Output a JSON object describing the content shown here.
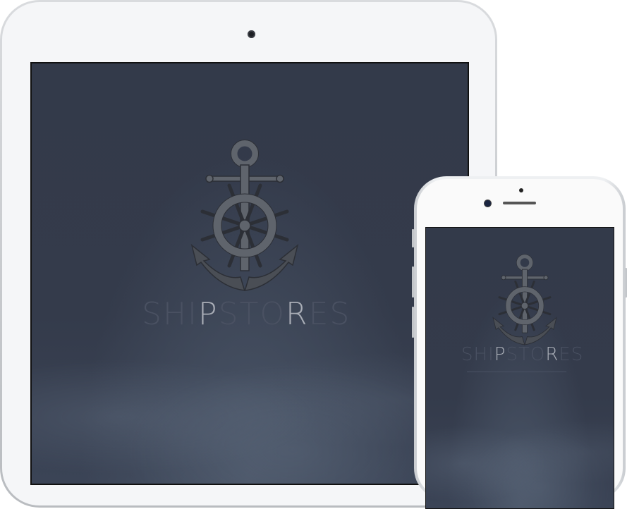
{
  "brand": {
    "letters": [
      "S",
      "H",
      "I",
      "P",
      "S",
      "T",
      "O",
      "R",
      "E",
      "S"
    ],
    "highlighted_letters": [
      3,
      7
    ],
    "text": "SHIPSTORES"
  },
  "colors": {
    "screen_background": "#343b4b",
    "logo": "#5f646c",
    "brand_dim": "#4a5162",
    "brand_highlight": "#a9adb6",
    "device_bezel": "#f5f6f8"
  },
  "icons": {
    "logo": "anchor-with-ship-wheel-icon"
  }
}
